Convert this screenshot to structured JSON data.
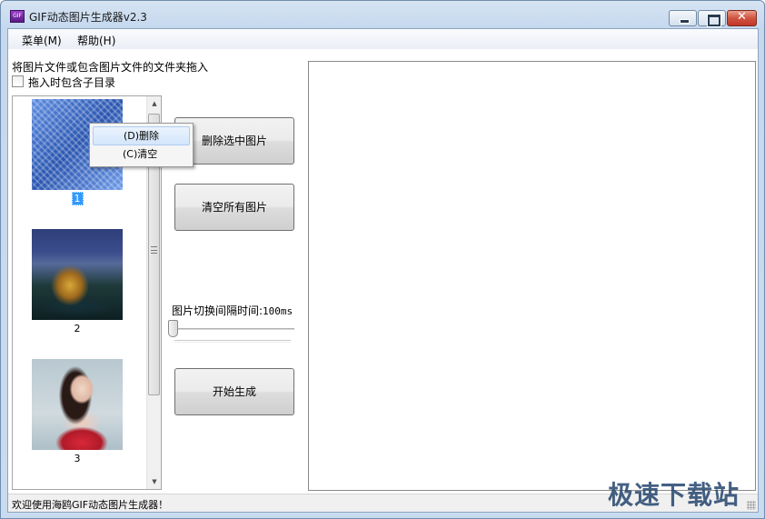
{
  "window": {
    "icon_text": "GIF",
    "title": "GIF动态图片生成器v2.3",
    "close_glyph": "✕"
  },
  "menubar": {
    "items": [
      {
        "label": "菜单(M)"
      },
      {
        "label": "帮助(H)"
      }
    ]
  },
  "left_panel": {
    "drop_hint": "将图片文件或包含图片文件的文件夹拖入",
    "include_subdirs_label": "拖入时包含子目录",
    "include_subdirs_checked": false,
    "images": [
      {
        "index_label": "1",
        "selected": true
      },
      {
        "index_label": "2",
        "selected": false
      },
      {
        "index_label": "3",
        "selected": false
      }
    ]
  },
  "context_menu": {
    "items": [
      {
        "label": "(D)删除",
        "highlighted": true
      },
      {
        "label": "(C)清空",
        "highlighted": false
      }
    ]
  },
  "controls": {
    "delete_selected_label": "删除选中图片",
    "clear_all_label": "清空所有图片",
    "interval_label": "图片切换间隔时间:",
    "interval_value": "100ms",
    "interval_slider_fraction": 0.0,
    "start_label": "开始生成"
  },
  "statusbar": {
    "text": "欢迎使用海鸥GIF动态图片生成器！"
  },
  "watermark": {
    "text": "极速下载站"
  },
  "icons": {
    "app": "gif-app-icon",
    "minimize": "minimize-icon",
    "maximize": "maximize-icon",
    "close": "close-icon",
    "scroll_up": "chevron-up-icon",
    "scroll_down": "chevron-down-icon"
  }
}
